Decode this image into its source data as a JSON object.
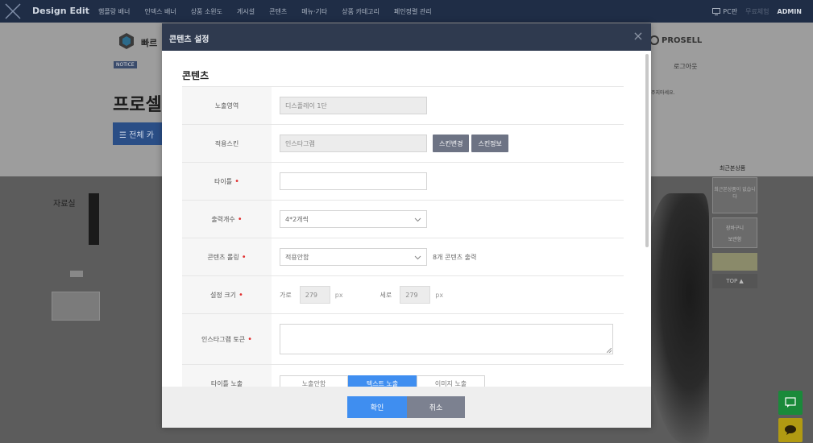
{
  "topbar": {
    "brand": "Design Edit",
    "menu": [
      "햄플랑 배너",
      "인덱스 배너",
      "상품 소윈도",
      "게시설",
      "콘텐츠",
      "메뉴·기타",
      "상품 카테고리",
      "페인정렬 관리"
    ],
    "pc_label": "PC판",
    "my_label": "무료체험",
    "admin_label": "ADMIN"
  },
  "background": {
    "brand": "빠르",
    "prosell": "PROSELL",
    "notice": "NOTICE",
    "right_text": "로그아웃",
    "side_msg": "주지마세요.",
    "title": "프로셀",
    "category_button": "전체 카",
    "recent_title": "최근본상품",
    "recent_empty": "최근본상품이 없습니다",
    "cart": "장바구니",
    "cart_sub": "보관함",
    "top_button": "TOP ▲",
    "hw_text": "자료실"
  },
  "modal": {
    "title": "콘텐츠 설정",
    "section_title": "콘텐츠",
    "rows": {
      "area": {
        "label": "노출영역",
        "value": "디스플레이 1단"
      },
      "skin": {
        "label": "적용스킨",
        "value": "인스타그램",
        "btn_change": "스킨변경",
        "btn_info": "스킨정보"
      },
      "title": {
        "label": "타이틀",
        "value": ""
      },
      "count": {
        "label": "출력개수",
        "value": "4*2개씩"
      },
      "rolling": {
        "label": "콘텐츠 롤링",
        "value": "적용안함",
        "after": "8개 콘텐츠 출력"
      },
      "size": {
        "label": "설정 크기",
        "w_label": "가로",
        "w_value": "279",
        "h_label": "세로",
        "h_value": "279",
        "unit": "px"
      },
      "token": {
        "label": "인스타그램 토큰",
        "value": ""
      },
      "title_show": {
        "label": "타이틀 노출",
        "options": [
          "노출안함",
          "텍스트 노출",
          "이미지 노출"
        ],
        "selected": 1
      }
    },
    "ok_label": "확인",
    "cancel_label": "취소"
  },
  "colors": {
    "topbar": "#1f2d46",
    "modal_header": "#2f3a4f",
    "primary": "#3f8ef0",
    "required": "#e03030"
  }
}
